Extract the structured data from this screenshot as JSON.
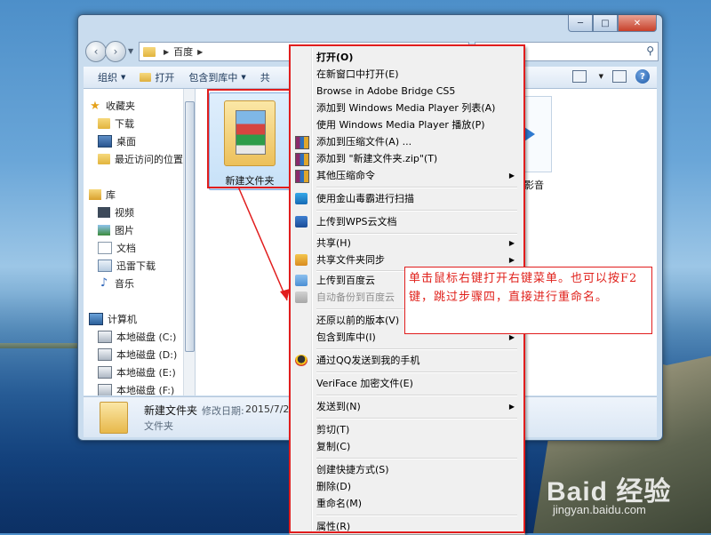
{
  "window": {
    "caption_buttons": {
      "minimize": "─",
      "maximize": "□",
      "close": "✕"
    },
    "nav": {
      "back": "‹",
      "forward": "›",
      "dropdown": "▼"
    },
    "address": {
      "sep1": "▶",
      "path": "百度",
      "sep2": "▶"
    },
    "search": {
      "icon": "⚲"
    },
    "toolbar": {
      "organize": "组织",
      "open": "打开",
      "include_in_library": "包含到库中",
      "partial": "共",
      "arrow": "▼",
      "help": "?"
    },
    "nav_pane": {
      "favorites": {
        "label": "收藏夹",
        "items": [
          "下载",
          "桌面",
          "最近访问的位置"
        ]
      },
      "libraries": {
        "label": "库",
        "items": [
          "视频",
          "图片",
          "文档",
          "迅雷下载",
          "音乐"
        ]
      },
      "computer": {
        "label": "计算机",
        "items": [
          "本地磁盘 (C:)",
          "本地磁盘 (D:)",
          "本地磁盘 (E:)",
          "本地磁盘 (F:)"
        ]
      }
    },
    "content": {
      "folder_label": "新建文件夹",
      "media_label": "影音"
    },
    "details": {
      "name": "新建文件夹",
      "modified_label": "修改日期:",
      "modified_value": "2015/7/20",
      "type": "文件夹"
    }
  },
  "context_menu": {
    "items": [
      {
        "label": "打开(O)",
        "bold": true
      },
      {
        "label": "在新窗口中打开(E)"
      },
      {
        "label": "Browse in Adobe Bridge CS5"
      },
      {
        "label": "添加到 Windows Media Player 列表(A)"
      },
      {
        "label": "使用 Windows Media Player 播放(P)"
      },
      {
        "label": "添加到压缩文件(A) ...",
        "icon": "winrar-icon"
      },
      {
        "label": "添加到 \"新建文件夹.zip\"(T)",
        "icon": "winrar-icon"
      },
      {
        "label": "其他压缩命令",
        "icon": "winrar-icon",
        "submenu": true
      },
      {
        "label": "使用金山毒霸进行扫描",
        "icon": "jinshan-icon"
      },
      {
        "label": "上传到WPS云文档",
        "icon": "wps-icon"
      },
      {
        "label": "共享(H)",
        "submenu": true
      },
      {
        "label": "共享文件夹同步",
        "icon": "sync-icon",
        "submenu": true
      },
      {
        "label": "上传到百度云",
        "icon": "baidu-cloud-icon"
      },
      {
        "label": "自动备份到百度云",
        "icon": "baidu-cloud-gray-icon",
        "disabled": true
      },
      {
        "label": "还原以前的版本(V)"
      },
      {
        "label": "包含到库中(I)",
        "submenu": true
      },
      {
        "label": "通过QQ发送到我的手机",
        "icon": "qq-icon"
      },
      {
        "label": "VeriFace 加密文件(E)"
      },
      {
        "label": "发送到(N)",
        "submenu": true
      },
      {
        "label": "剪切(T)"
      },
      {
        "label": "复制(C)"
      },
      {
        "label": "创建快捷方式(S)"
      },
      {
        "label": "删除(D)"
      },
      {
        "label": "重命名(M)"
      },
      {
        "label": "属性(R)"
      }
    ],
    "submenu_arrow": "▶"
  },
  "annotation": {
    "text": "单击鼠标右键打开右键菜单。也可以按F2键，跳过步骤四，直接进行重命名。",
    "color": "#e0221c"
  },
  "watermark": {
    "logo": "Baid 经验",
    "url": "jingyan.baidu.com"
  }
}
